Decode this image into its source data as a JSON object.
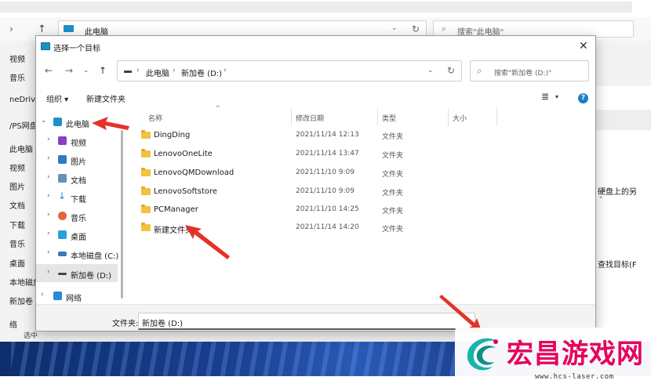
{
  "background_window": {
    "address_text": "此电脑",
    "search_placeholder": "搜索\"此电脑\"",
    "sidebar_items": [
      "视频",
      "音乐",
      "neDrive",
      "/PS网盘",
      "此电脑",
      "视频",
      "图片",
      "文档",
      "下载",
      "音乐",
      "桌面",
      "本地磁盘",
      "新加卷 (",
      "络"
    ],
    "right_text_1": "硬盘上的另",
    "right_text_2": "\"",
    "right_text_3": "查找目标(F",
    "status_text": "选中"
  },
  "dialog": {
    "title": "选择一个目标",
    "address": {
      "segments": [
        "此电脑",
        "新加卷 (D:)"
      ]
    },
    "search_placeholder": "搜索\"新加卷 (D:)\"",
    "toolbar": {
      "organize": "组织 ▾",
      "new_folder": "新建文件夹"
    },
    "tree": [
      {
        "label": "此电脑",
        "icon": "computer-icon",
        "color": "#1e90c8",
        "expanded": true
      },
      {
        "label": "视频",
        "icon": "video-icon",
        "color": "#8a3fc2"
      },
      {
        "label": "图片",
        "icon": "picture-icon",
        "color": "#2f7bc4"
      },
      {
        "label": "文档",
        "icon": "document-icon",
        "color": "#6b8fb3"
      },
      {
        "label": "下载",
        "icon": "download-icon",
        "color": "#1f86d6"
      },
      {
        "label": "音乐",
        "icon": "music-icon",
        "color": "#e0663c"
      },
      {
        "label": "桌面",
        "icon": "desktop-icon",
        "color": "#2aa0d9"
      },
      {
        "label": "本地磁盘 (C:)",
        "icon": "disk-c-icon",
        "color": "#3c78b8"
      },
      {
        "label": "新加卷 (D:)",
        "icon": "disk-d-icon",
        "color": "#444444",
        "selected": true
      },
      {
        "label": "网络",
        "icon": "network-icon",
        "color": "#2a8ad6"
      }
    ],
    "columns": [
      "名称",
      "修改日期",
      "类型",
      "大小"
    ],
    "rows": [
      {
        "name": "DingDing",
        "date": "2021/11/14 12:13",
        "type": "文件夹"
      },
      {
        "name": "LenovoOneLite",
        "date": "2021/11/14 13:47",
        "type": "文件夹"
      },
      {
        "name": "LenovoQMDownload",
        "date": "2021/11/10 9:09",
        "type": "文件夹"
      },
      {
        "name": "LenovoSoftstore",
        "date": "2021/11/10 9:09",
        "type": "文件夹"
      },
      {
        "name": "PCManager",
        "date": "2021/11/10 14:25",
        "type": "文件夹"
      },
      {
        "name": "新建文件夹",
        "date": "2021/11/14 14:20",
        "type": "文件夹"
      }
    ],
    "folder_label": "文件夹:",
    "folder_value": "新加卷 (D:)"
  },
  "watermark": {
    "brand": "宏昌游戏网",
    "url": "www.hcs-laser.com"
  },
  "colors": {
    "annotation_red": "#e5312a",
    "brand_magenta": "#e6005c",
    "folder_yellow": "#f5c142",
    "help_blue": "#1a7fc9"
  }
}
